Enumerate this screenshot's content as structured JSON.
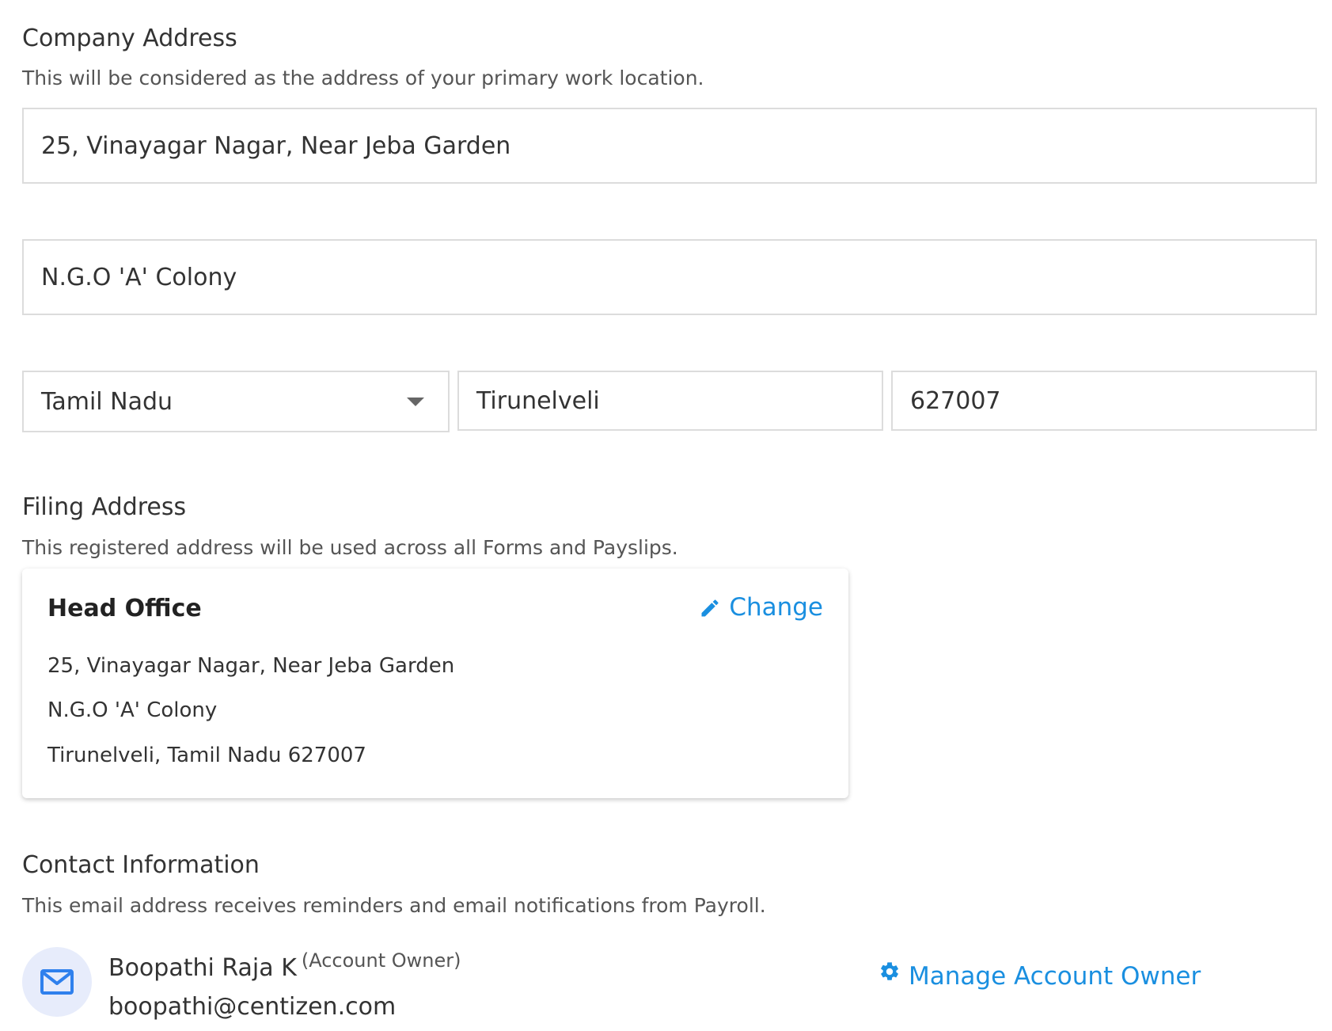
{
  "company_address": {
    "title": "Company Address",
    "description": "This will be considered as the address of your primary work location.",
    "address_line1": "25, Vinayagar Nagar, Near Jeba Garden",
    "address_line2": "N.G.O 'A' Colony",
    "state": "Tamil Nadu",
    "city": "Tirunelveli",
    "pincode": "627007"
  },
  "filing_address": {
    "title": "Filing Address",
    "description": "This registered address will be used across all Forms and Payslips.",
    "card": {
      "title": "Head Office",
      "change_label": "Change",
      "line1": "25, Vinayagar Nagar, Near Jeba Garden",
      "line2": "N.G.O 'A' Colony",
      "line3": "Tirunelveli, Tamil Nadu 627007"
    }
  },
  "contact_information": {
    "title": "Contact Information",
    "description": "This email address receives reminders and email notifications from Payroll.",
    "owner_name": "Boopathi Raja K",
    "owner_role": "(Account Owner)",
    "owner_email": "boopathi@centizen.com",
    "manage_label": "Manage Account Owner"
  },
  "colors": {
    "link": "#1a8fe0",
    "avatar_bg": "#e7ecfb",
    "mail_icon": "#2f80ed"
  }
}
